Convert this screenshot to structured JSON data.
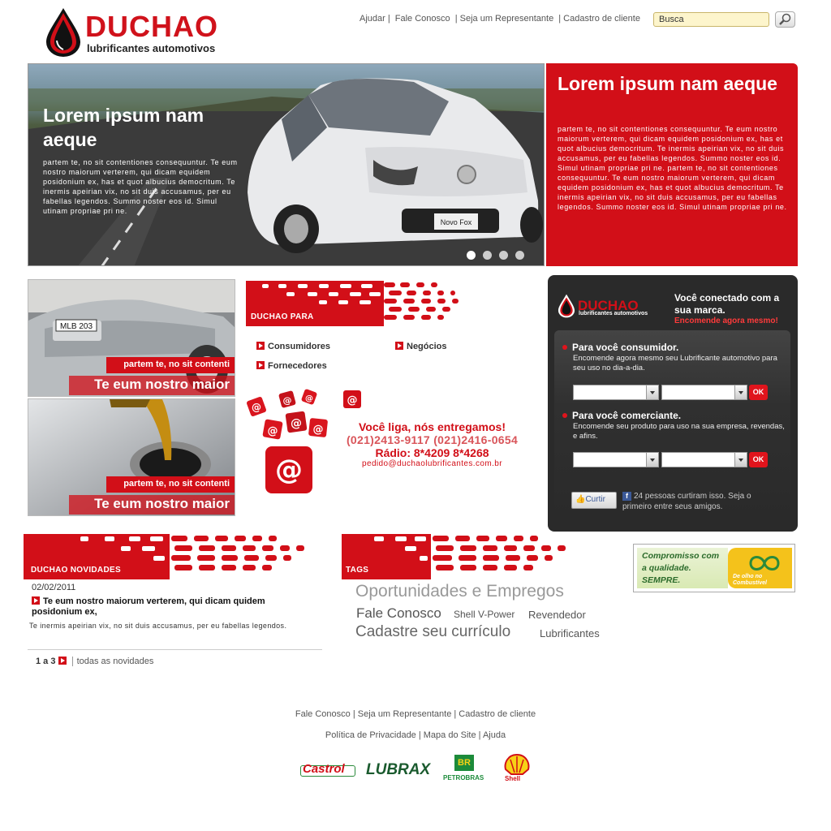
{
  "header": {
    "logo_name": "DUCHAO",
    "logo_sub": "lubrificantes automotivos",
    "nav": [
      "Ajudar |",
      "Fale Conosco",
      "| Seja um Representante",
      "| Cadastro de cliente"
    ],
    "search_value": "Busca"
  },
  "hero": {
    "title": "Lorem ipsum nam aeque",
    "text": "partem te, no sit contentiones consequuntur. Te eum nostro maiorum verterem, qui dicam equidem posidonium ex, has et quot albucius democritum. Te inermis apeirian vix, no sit duis accusamus, per eu fabellas legendos. Summo noster eos id. Simul utinam propriae pri ne.",
    "car_plate": "Novo Fox",
    "slides": 4,
    "active_slide": 1
  },
  "redpanel": {
    "title": "Lorem ipsum nam aeque",
    "text": "partem te, no sit contentiones consequuntur. Te eum nostro maiorum verterem, qui dicam equidem posidonium ex, has et quot albucius democritum. Te inermis apeirian vix, no sit duis accusamus, per eu fabellas legendos. Summo noster eos id. Simul utinam propriae pri ne. partem te, no sit contentiones consequuntur. Te eum nostro maiorum verterem, qui dicam equidem posidonium ex, has et quot albucius democritum. Te inermis apeirian vix, no sit duis accusamus, per eu fabellas legendos. Summo noster eos id. Simul utinam propriae pri ne."
  },
  "tiles": [
    {
      "caption": "partem te, no sit contenti",
      "big": "Te eum nostro maior",
      "plate": "MLB 203"
    },
    {
      "caption": "partem te, no sit contenti",
      "big": "Te eum nostro maior"
    }
  ],
  "para": {
    "title": "DUCHAO PARA",
    "links": [
      "Consumidores",
      "Negócios",
      "Fornecedores"
    ],
    "call1": "Você liga, nós entregamos!",
    "call2": "(021)2413-9117 (021)2416-0654",
    "call3": "Rádio: 8*4209 8*4268",
    "call4": "pedido@duchaolubrificantes.com.br"
  },
  "dark": {
    "logo_name": "DUCHAO",
    "logo_sub": "lubrificantes automotivos",
    "tagline": "Você conectado com a sua marca.",
    "tagline2": "Encomende agora mesmo!",
    "cons_title": "Para você consumidor.",
    "cons_text": "Encomende agora mesmo seu Lubrificante automotivo para seu uso no dia-a-dia.",
    "com_title": "Para você comerciante.",
    "com_text": "Encomende seu produto para uso na sua empresa, revendas, e afins.",
    "ok": "OK",
    "like": "Curtir",
    "fb_text": "24 pessoas curtiram isso. Seja o primeiro entre seus amigos."
  },
  "news": {
    "title": "DUCHAO NOVIDADES",
    "date": "02/02/2011",
    "headline": "Te eum nostro maiorum verterem, qui dicam quidem posidonium ex,",
    "text": "Te inermis apeirian vix, no sit duis accusamus, per eu fabellas legendos.",
    "pager": "1 a 3",
    "all": "todas as novidades"
  },
  "tags": {
    "title": "TAGS",
    "items": [
      "Oportunidades e Empregos",
      "Fale Conosco",
      "Shell V-Power",
      "Revendedor",
      "Cadastre seu currículo",
      "Lubrificantes"
    ]
  },
  "promo": {
    "text": "Compromisso com a qualidade. SEMPRE.",
    "badge": "De olho no Combustível"
  },
  "footer": {
    "line1": "Fale Conosco  | Seja um Representante | Cadastro de cliente",
    "line2": "Política de Privacidade | Mapa do Site | Ajuda",
    "brands": [
      "Castrol",
      "LUBRAX",
      "PETROBRAS",
      "Shell"
    ]
  },
  "colors": {
    "brand_red": "#d20f18",
    "dark_box": "#2a2a2a"
  }
}
